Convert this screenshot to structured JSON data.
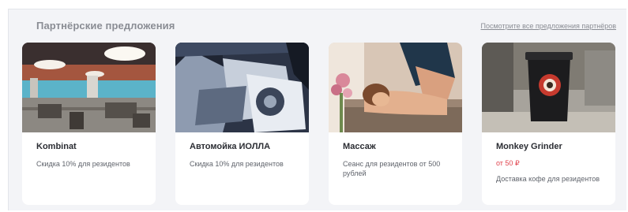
{
  "section": {
    "title": "Партнёрские предложения",
    "all_link": "Посмотрите все предложения партнёров"
  },
  "cards": [
    {
      "title": "Kombinat",
      "price": "",
      "desc": "Скидка 10% для резидентов"
    },
    {
      "title": "Автомойка ИОЛЛА",
      "price": "",
      "desc": "Скидка 10% для резидентов"
    },
    {
      "title": "Массаж",
      "price": "",
      "desc": "Сеанс для резидентов от 500 рублей"
    },
    {
      "title": "Monkey Grinder",
      "price": "от 50 ₽",
      "desc": "Доставка кофе для резидентов"
    }
  ],
  "colors": {
    "panel_bg": "#f3f4f7",
    "title_gray": "#8a8d94",
    "price_red": "#e0444e"
  }
}
